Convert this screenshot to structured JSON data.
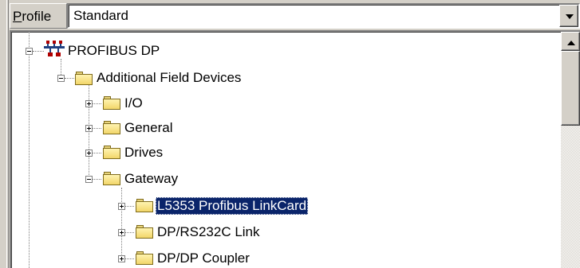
{
  "profile": {
    "label_first": "P",
    "label_rest": "rofile",
    "value": "Standard"
  },
  "tree": {
    "nodes": [
      {
        "label": "PROFIBUS DP",
        "icon": "network-icon",
        "expanded": true
      },
      {
        "label": "Additional Field Devices",
        "icon": "folder-icon",
        "expanded": true
      },
      {
        "label": "I/O",
        "icon": "folder-icon",
        "expanded": false
      },
      {
        "label": "General",
        "icon": "folder-icon",
        "expanded": false
      },
      {
        "label": "Drives",
        "icon": "folder-icon",
        "expanded": false
      },
      {
        "label": "Gateway",
        "icon": "folder-icon",
        "expanded": true
      },
      {
        "label": "L5353 Profibus LinkCard",
        "icon": "folder-icon",
        "expanded": false,
        "selected": true
      },
      {
        "label": "DP/RS232C Link",
        "icon": "folder-icon",
        "expanded": false
      },
      {
        "label": "DP/DP Coupler",
        "icon": "folder-icon",
        "expanded": false
      }
    ]
  },
  "colors": {
    "selection_bg": "#0a246a",
    "window_bg": "#d4d0c8",
    "folder": "#f2d66a"
  }
}
